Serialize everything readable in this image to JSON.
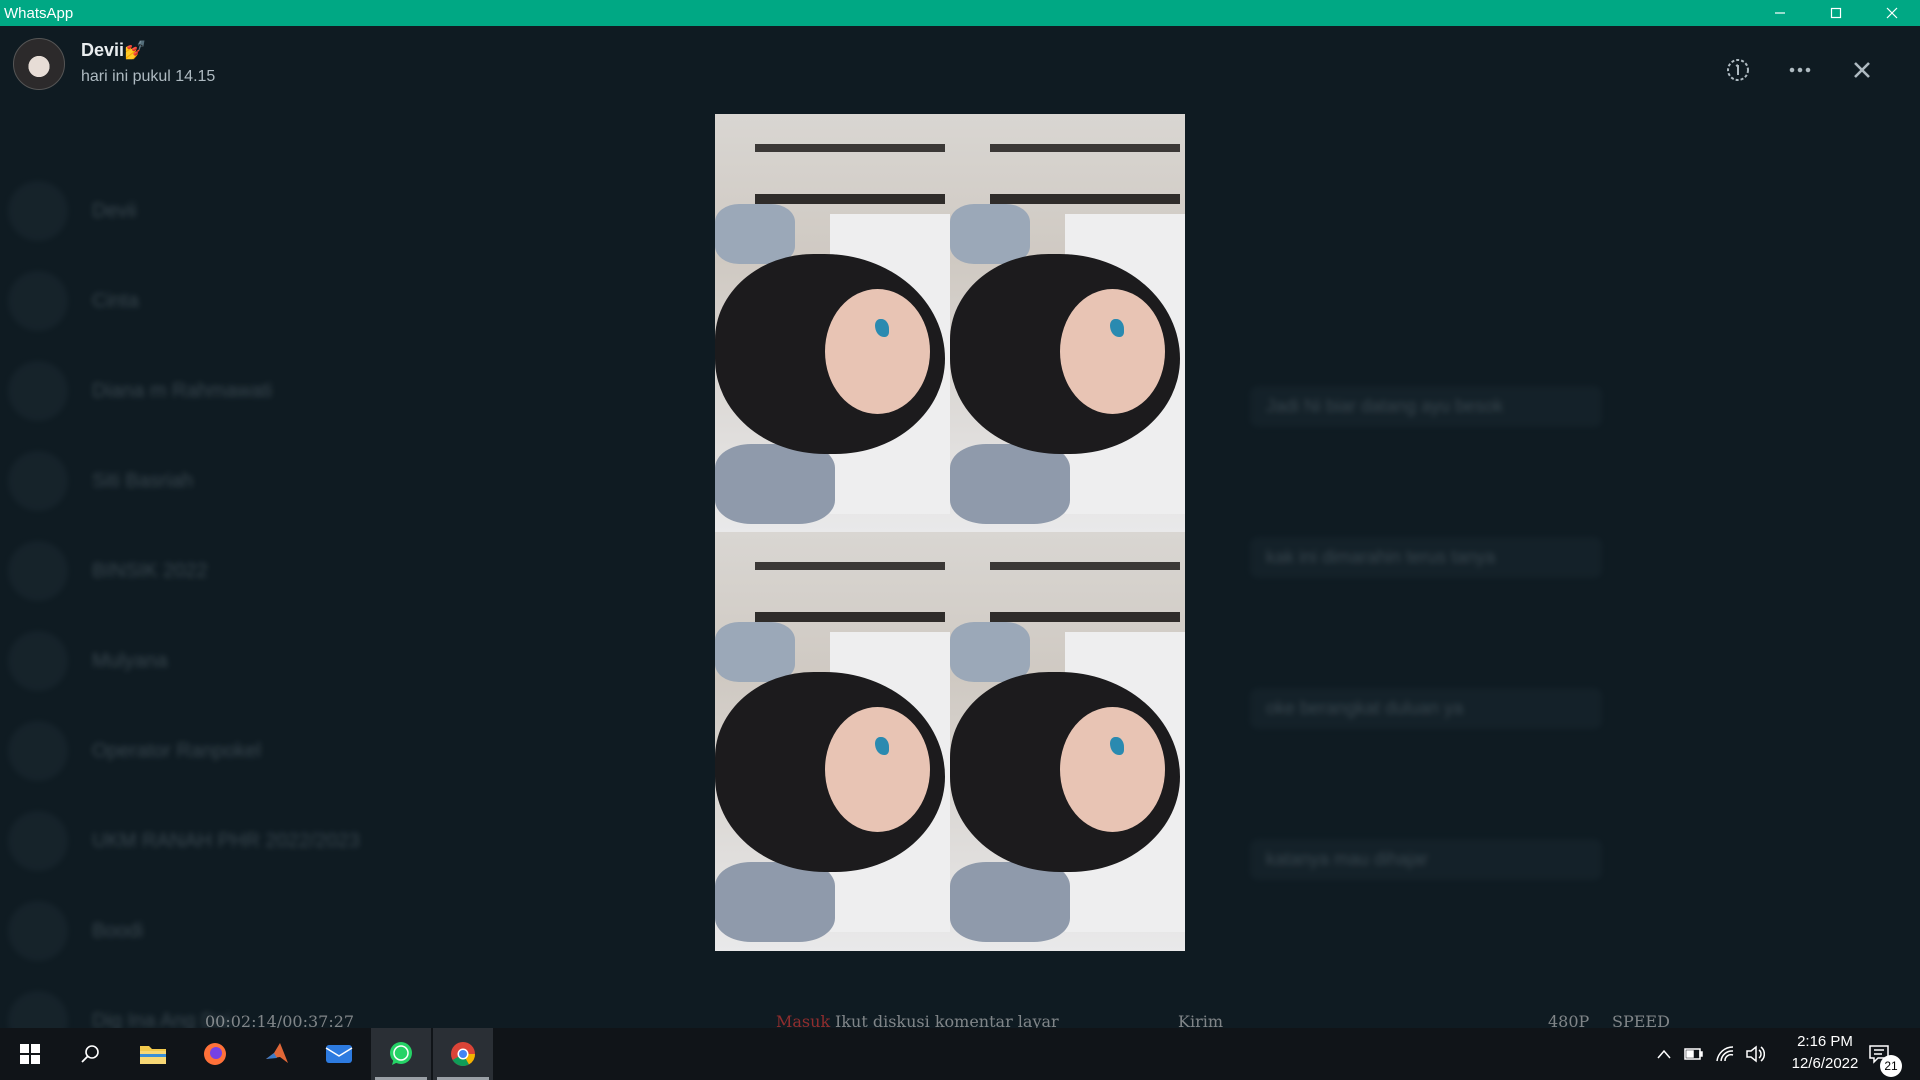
{
  "window": {
    "title": "WhatsApp"
  },
  "viewer": {
    "sender_name": "Devii💅",
    "timestamp": "hari ini pukul 14.15"
  },
  "background_chats": [
    "Devii",
    "Cinta",
    "Diana m Rahmawati",
    "Siti Basriah",
    "BINSIK 2022",
    "Mulyana",
    "Operator Ranpokel",
    "UKM RANAH PHR 2022/2023",
    "Boodi",
    "Dig Ina Ang Dai"
  ],
  "background_bubbles": [
    "Jadi Ni biar datang ayu besok",
    "kak ini dimarahin terus tanya",
    "oke berangkat duluan ya",
    "katanya mau dihajar"
  ],
  "bottom_strip": {
    "player_time": "00:02:14/00:37:27",
    "comment_label": "Masuk",
    "comment_text": "Ikut diskusi komentar layar",
    "send_label": "Kirim",
    "quality": "480P",
    "speed": "SPEED"
  },
  "taskbar": {
    "apps": [
      {
        "name": "start",
        "icon": "windows-icon"
      },
      {
        "name": "search",
        "icon": "search-icon"
      },
      {
        "name": "file-explorer",
        "icon": "folder-icon"
      },
      {
        "name": "firefox",
        "icon": "firefox-icon"
      },
      {
        "name": "matlab",
        "icon": "matlab-icon"
      },
      {
        "name": "mail",
        "icon": "mail-icon"
      },
      {
        "name": "whatsapp",
        "icon": "whatsapp-icon"
      },
      {
        "name": "chrome",
        "icon": "chrome-icon"
      }
    ],
    "time": "2:16 PM",
    "date": "12/6/2022",
    "notification_count": "21"
  },
  "colors": {
    "accent": "#00a884",
    "background": "#0b141a"
  }
}
